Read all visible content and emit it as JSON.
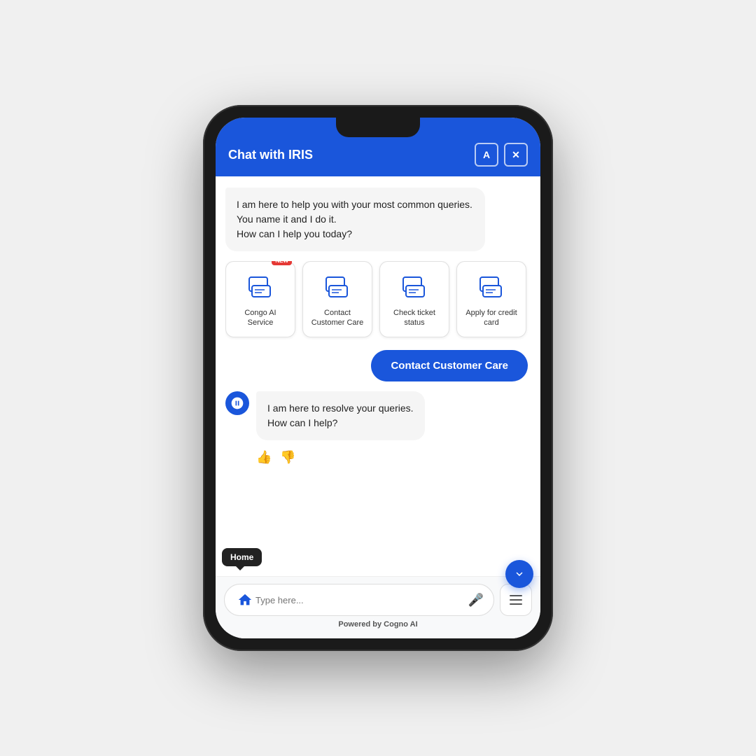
{
  "header": {
    "title": "Chat with IRIS",
    "translate_btn": "A",
    "close_btn": "×"
  },
  "messages": [
    {
      "type": "bot",
      "text": "I am here to help you with your most common queries. You name it and I do it.\nHow can I help you today?"
    }
  ],
  "quick_actions": [
    {
      "label": "Congo AI Service",
      "has_new": true
    },
    {
      "label": "Contact Customer Care",
      "has_new": false
    },
    {
      "label": "Check ticket status",
      "has_new": false
    },
    {
      "label": "Apply for credit card",
      "has_new": false
    }
  ],
  "user_message": "Contact Customer Care",
  "bot_response": "I am here to resolve your queries.\nHow can I help?",
  "input": {
    "placeholder": "Type here...",
    "home_tooltip": "Home"
  },
  "powered_by": {
    "prefix": "Powered by ",
    "brand": "Cogno AI"
  },
  "feedback": {
    "thumbs_up": "👍",
    "thumbs_down": "👎"
  }
}
